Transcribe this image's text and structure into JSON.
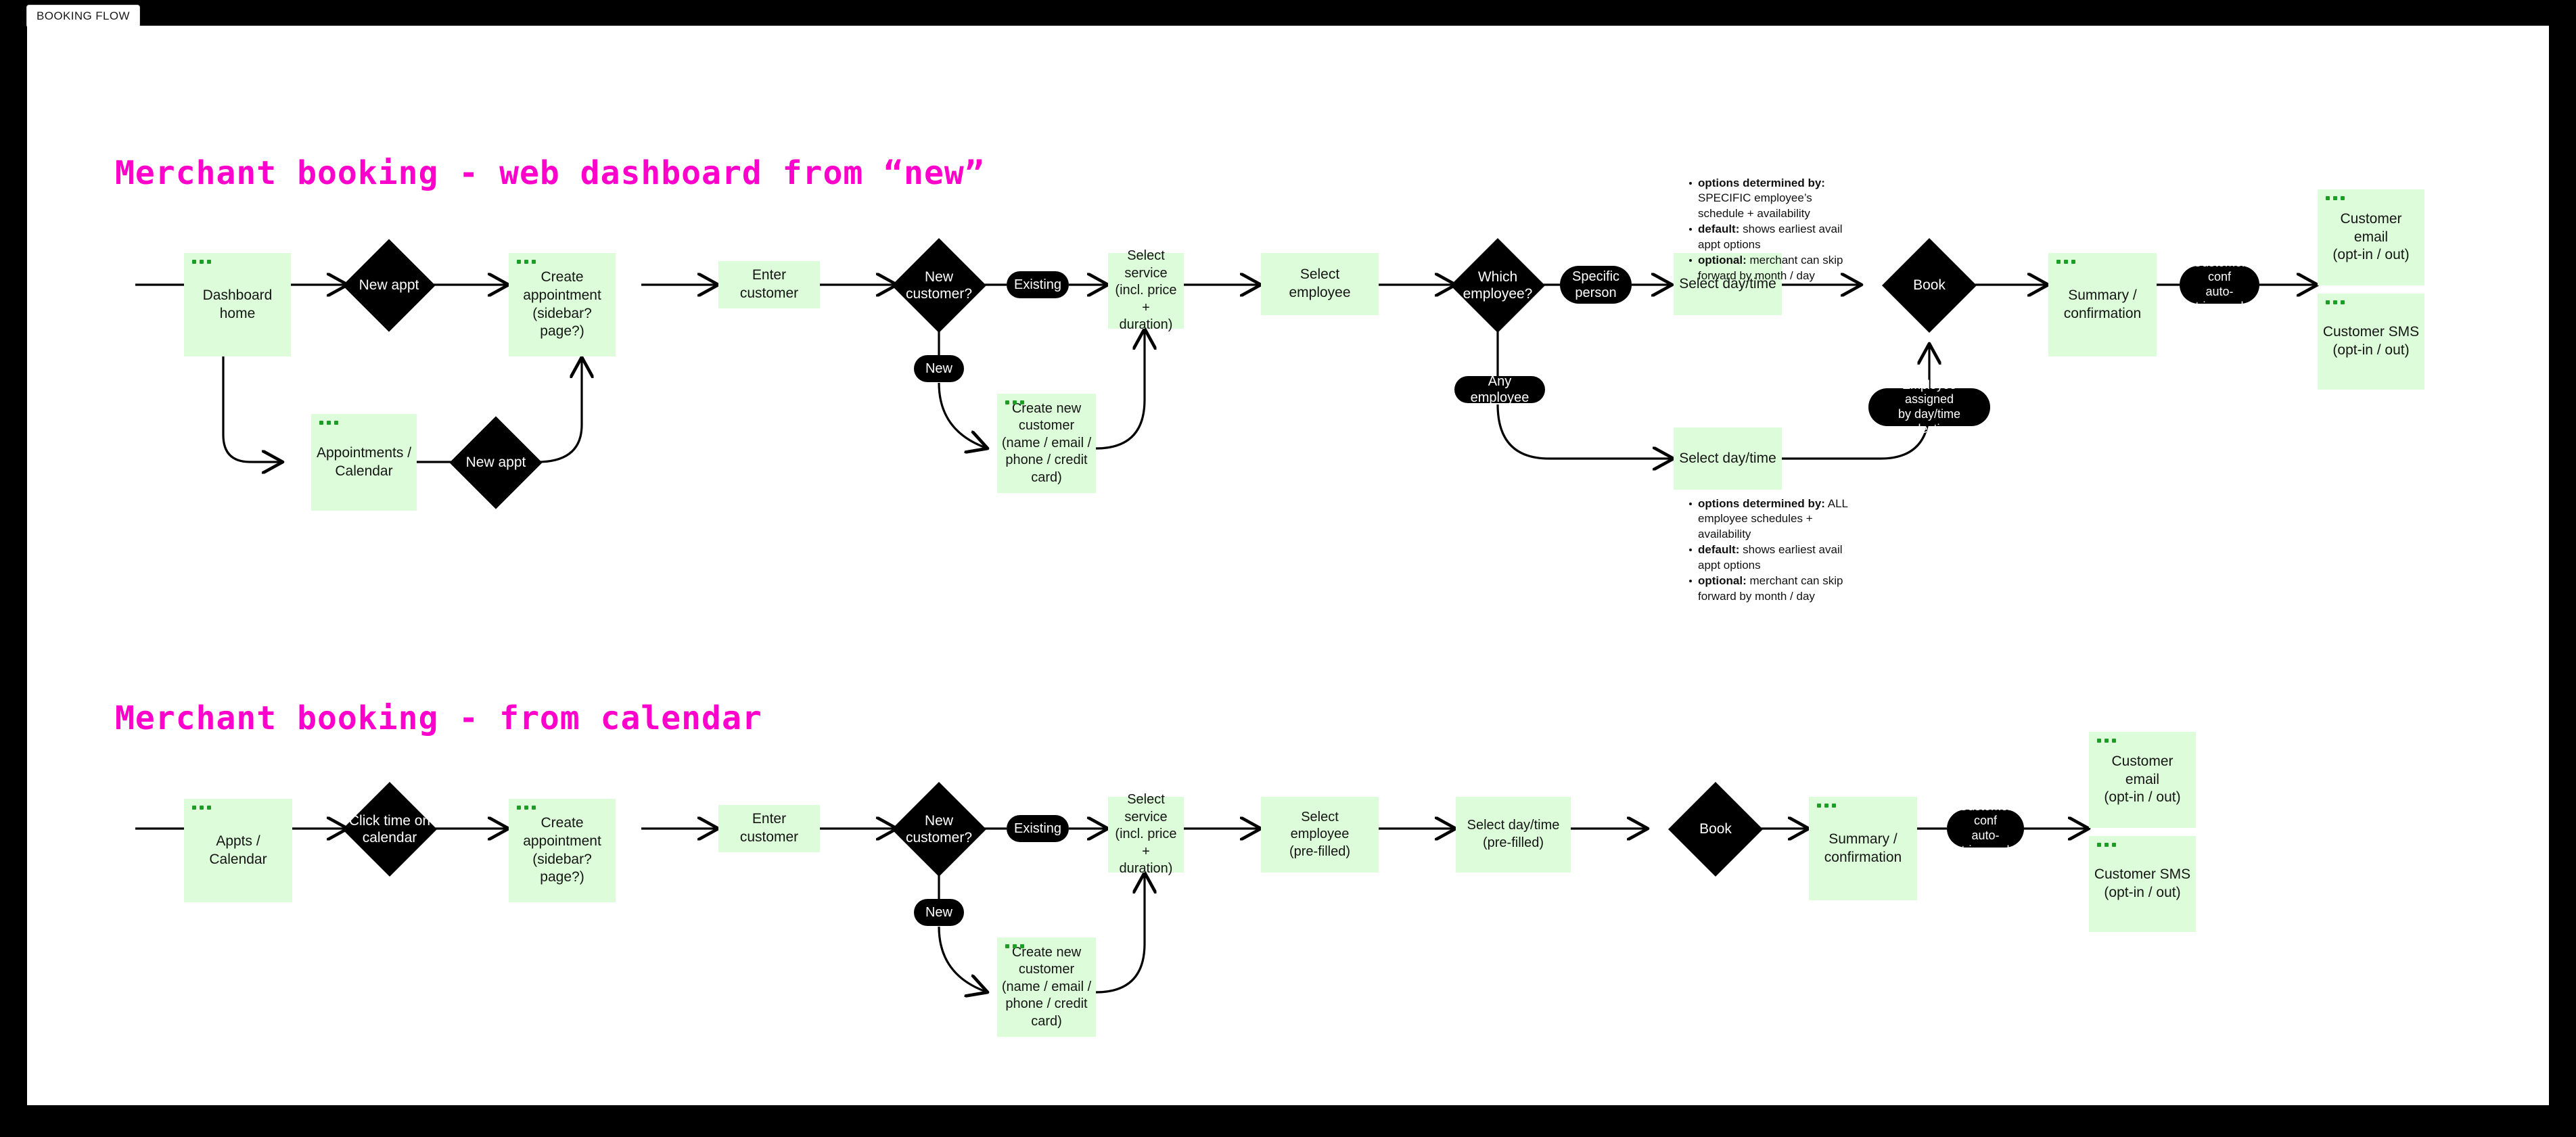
{
  "window": {
    "tab_label": "BOOKING FLOW"
  },
  "flows": [
    {
      "title": "Merchant booking - web dashboard from “new”",
      "nodes": {
        "dashboard_home": "Dashboard home",
        "appointments_calendar": "Appointments /\nCalendar",
        "create_appointment": "Create appointment\n(sidebar? page?)",
        "enter_customer": "Enter customer",
        "create_new_customer": "Create new\ncustomer\n(name / email /\nphone / credit card)",
        "select_service": "Select service\n(incl. price +\nduration)",
        "select_employee": "Select\nemployee",
        "select_daytime_specific": "Select day/time",
        "select_daytime_any": "Select day/time",
        "summary_confirmation": "Summary /\nconfirmation",
        "customer_email": "Customer email\n(opt-in / out)",
        "customer_sms": "Customer SMS\n(opt-in / out)"
      },
      "decisions": {
        "new_appt_top": "New appt",
        "new_appt_bottom": "New appt",
        "new_customer": "New\ncustomer?",
        "which_employee": "Which\nemployee?",
        "book": "Book"
      },
      "edge_labels": {
        "existing": "Existing",
        "new": "New",
        "specific_person": "Specific\nperson",
        "any_employee": "Any employee",
        "employee_assigned": "Employee assigned\nby day/time selection",
        "customer_conf": "Customer conf\nauto-triggered"
      },
      "annotations": [
        {
          "items": [
            {
              "lead": "options determined by:",
              "text": " SPECIFIC employee’s schedule + availability"
            },
            {
              "lead": "default:",
              "text": "  shows earliest avail appt options"
            },
            {
              "lead": "optional:",
              "text": "  merchant can skip forward by month / day"
            }
          ]
        },
        {
          "items": [
            {
              "lead": "options determined by:",
              "text": " ALL employee schedules + availability"
            },
            {
              "lead": "default:",
              "text": "  shows earliest avail appt options"
            },
            {
              "lead": "optional:",
              "text": "  merchant can skip forward by month / day"
            }
          ]
        }
      ]
    },
    {
      "title": "Merchant booking - from calendar",
      "nodes": {
        "appts_calendar": "Appts / Calendar",
        "create_appointment": "Create appointment\n(sidebar? page?)",
        "enter_customer": "Enter customer",
        "create_new_customer": "Create new\ncustomer\n(name / email /\nphone / credit card)",
        "select_service": "Select service\n(incl. price +\nduration)",
        "select_employee": "Select\nemployee\n(pre-filled)",
        "select_daytime": "Select day/time\n(pre-filled)",
        "summary_confirmation": "Summary /\nconfirmation",
        "customer_email": "Customer email\n(opt-in / out)",
        "customer_sms": "Customer SMS\n(opt-in / out)"
      },
      "decisions": {
        "click_time": "Click time on\ncalendar",
        "new_customer": "New\ncustomer?",
        "book": "Book"
      },
      "edge_labels": {
        "existing": "Existing",
        "new": "New",
        "customer_conf": "Customer conf\nauto-triggered"
      }
    }
  ],
  "colors": {
    "node_fill": "#ddfcd9",
    "dot": "#1c9e26",
    "title": "#ff00cc",
    "shape_dark": "#000000",
    "canvas": "#ffffff",
    "frame": "#000000"
  }
}
